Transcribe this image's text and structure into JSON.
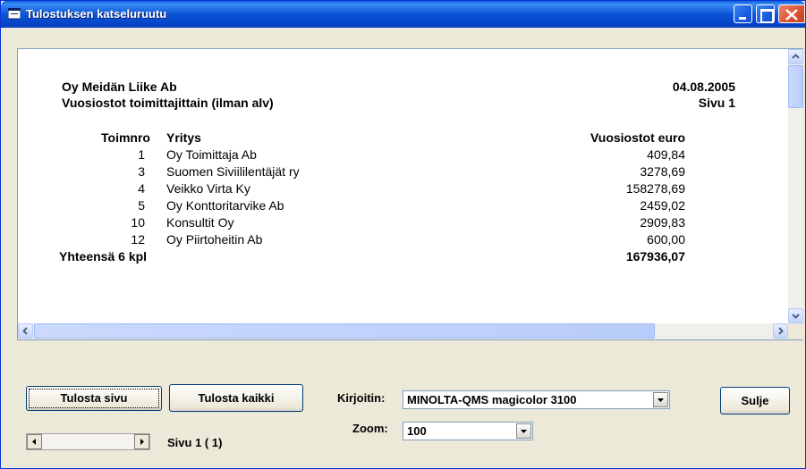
{
  "window": {
    "title": "Tulostuksen katseluruutu"
  },
  "report": {
    "company": "Oy Meidän Liike Ab",
    "subtitle": "Vuosiostot toimittajittain (ilman alv)",
    "date": "04.08.2005",
    "page": "Sivu 1",
    "columns": {
      "id": "Toimnro",
      "name": "Yritys",
      "amount": "Vuosiostot euro"
    },
    "rows": [
      {
        "id": "1",
        "name": "Oy Toimittaja Ab",
        "amount": "409,84"
      },
      {
        "id": "3",
        "name": "Suomen Siviililentäjät ry",
        "amount": "3278,69"
      },
      {
        "id": "4",
        "name": "Veikko Virta Ky",
        "amount": "158278,69"
      },
      {
        "id": "5",
        "name": "Oy Konttoritarvike Ab",
        "amount": "2459,02"
      },
      {
        "id": "10",
        "name": "Konsultit Oy",
        "amount": "2909,83"
      },
      {
        "id": "12",
        "name": "Oy Piirtoheitin Ab",
        "amount": "600,00"
      }
    ],
    "total_label": "Yhteensä 6 kpl",
    "total_amount": "167936,07"
  },
  "controls": {
    "print_page": "Tulosta sivu",
    "print_all": "Tulosta kaikki",
    "printer_label": "Kirjoitin:",
    "printer_value": "MINOLTA-QMS magicolor 3100",
    "zoom_label": "Zoom:",
    "zoom_value": "100",
    "page_status": "Sivu  1 ( 1)",
    "close": "Sulje"
  }
}
